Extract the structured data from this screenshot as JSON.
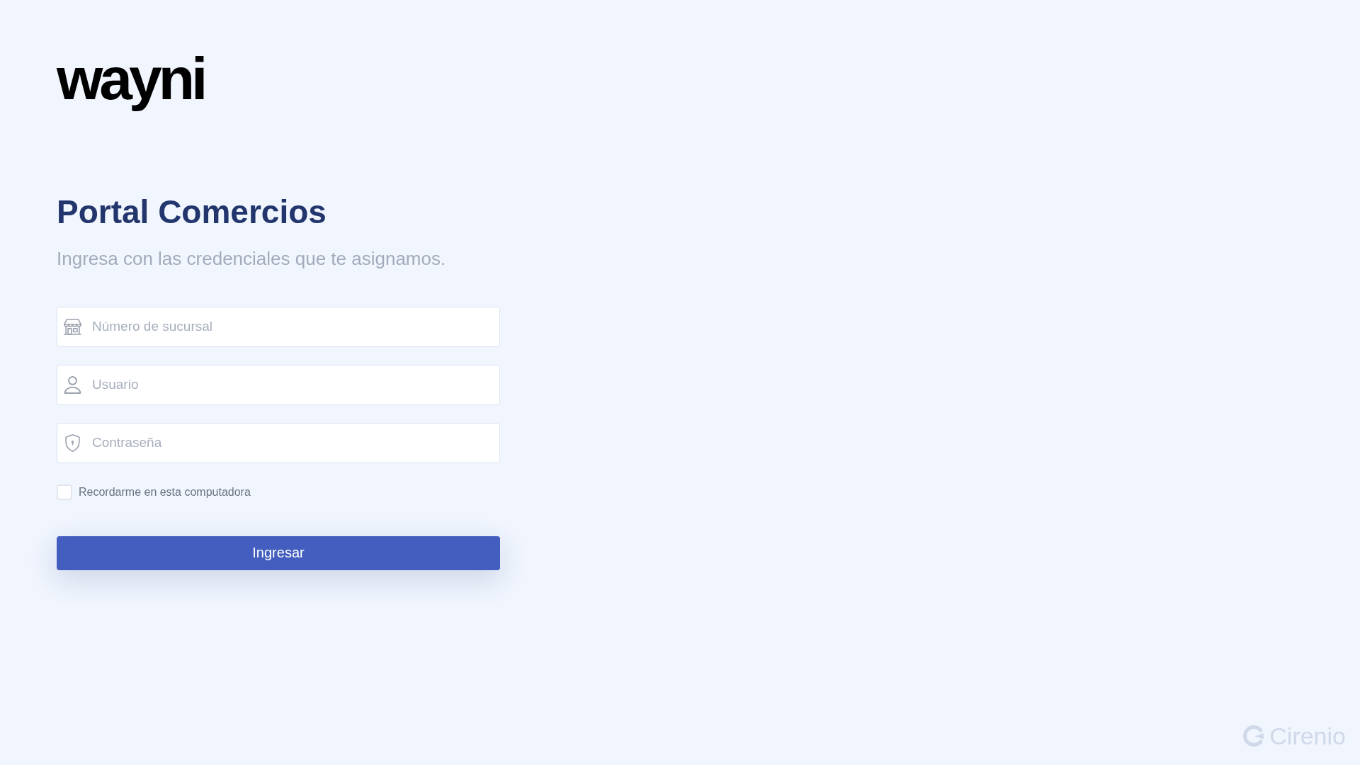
{
  "logo": {
    "text": "wayni"
  },
  "header": {
    "title": "Portal Comercios",
    "subtitle": "Ingresa con las credenciales que te asignamos."
  },
  "form": {
    "fields": [
      {
        "kind": "branch",
        "placeholder": "Número de sucursal"
      },
      {
        "kind": "user",
        "placeholder": "Usuario"
      },
      {
        "kind": "password",
        "placeholder": "Contraseña"
      }
    ],
    "remember": {
      "label": "Recordarme en esta computadora",
      "checked": false
    },
    "submit": {
      "label": "Ingresar"
    }
  },
  "footer": {
    "brand": "Cirenio"
  }
}
